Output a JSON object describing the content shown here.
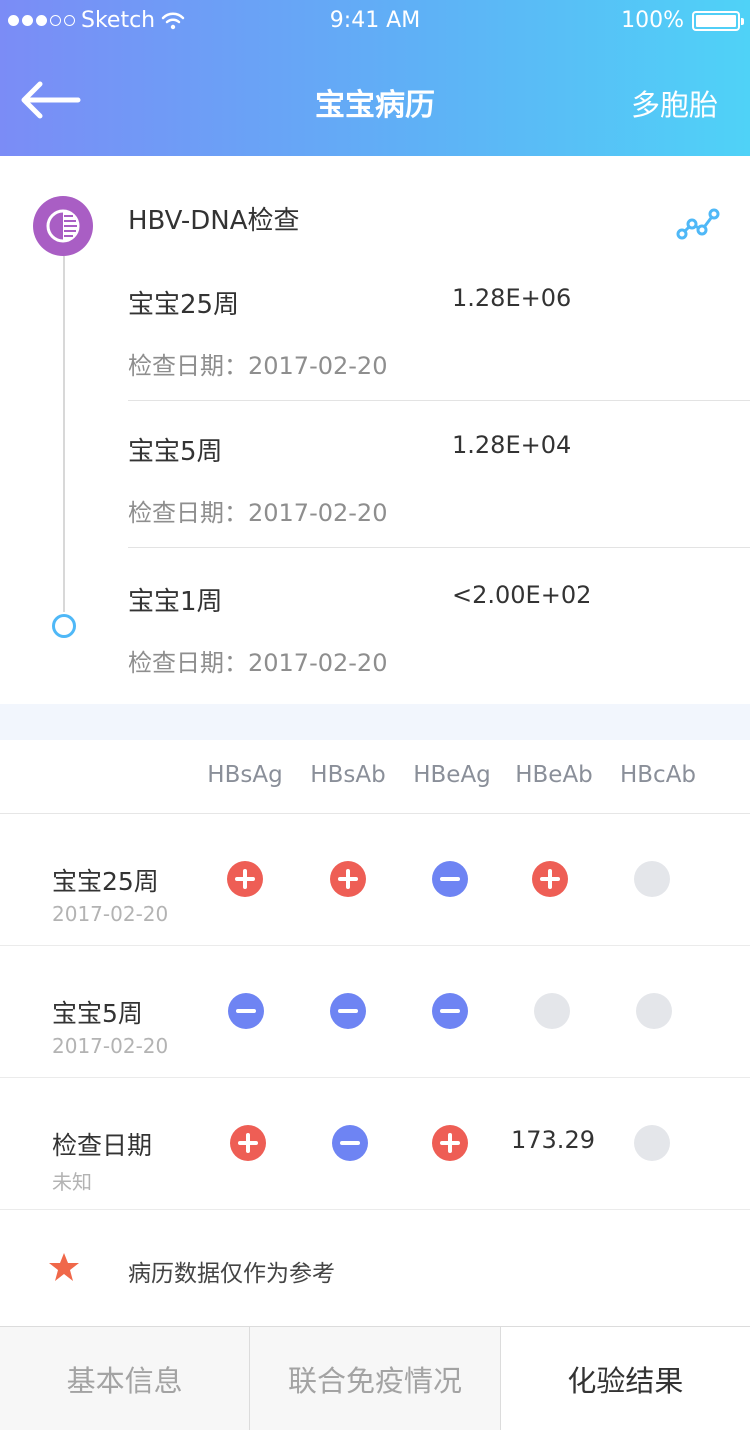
{
  "status_bar": {
    "carrier": "Sketch",
    "time": "9:41 AM",
    "battery": "100%"
  },
  "header": {
    "title": "宝宝病历",
    "right_action": "多胞胎"
  },
  "hbv": {
    "title": "HBV-DNA检查",
    "entries": [
      {
        "label": "宝宝25周",
        "value": "1.28E+06",
        "date": "检查日期：2017-02-20"
      },
      {
        "label": "宝宝5周",
        "value": "1.28E+04",
        "date": "检查日期：2017-02-20"
      },
      {
        "label": "宝宝1周",
        "value": "<2.00E+02",
        "date": "检查日期：2017-02-20"
      }
    ]
  },
  "table": {
    "columns": [
      "HBsAg",
      "HBsAb",
      "HBeAg",
      "HBeAb",
      "HBcAb"
    ],
    "rows": [
      {
        "name": "宝宝25周",
        "sub": "2017-02-20",
        "cells": [
          "positive",
          "positive",
          "negative",
          "positive",
          "none"
        ]
      },
      {
        "name": "宝宝5周",
        "sub": "2017-02-20",
        "cells": [
          "negative",
          "negative",
          "negative",
          "none",
          "none"
        ]
      },
      {
        "name": "检查日期",
        "sub": "未知",
        "cells": [
          "positive",
          "negative",
          "positive",
          "173.29",
          "none"
        ]
      }
    ]
  },
  "note": {
    "text": "病历数据仅作为参考"
  },
  "tabs": [
    {
      "label": "基本信息",
      "active": false
    },
    {
      "label": "联合免疫情况",
      "active": false
    },
    {
      "label": "化验结果",
      "active": true
    }
  ],
  "colors": {
    "positive": "#ee5e55",
    "negative": "#6e84f3",
    "none": "#e4e6ea",
    "accent": "#4fb8f7",
    "hbv_icon": "#a95ec4",
    "star": "#f0684a"
  }
}
